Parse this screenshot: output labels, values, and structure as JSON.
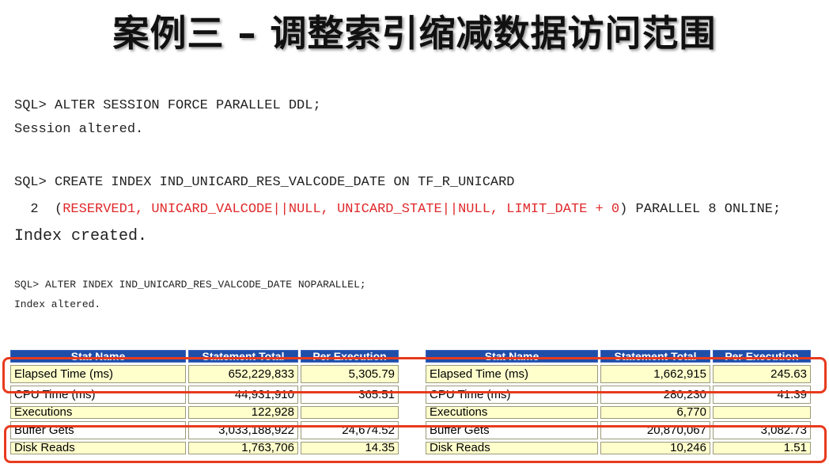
{
  "slide": {
    "title": "案例三 – 调整索引缩减数据访问范围"
  },
  "console": {
    "line1": "SQL> ALTER SESSION FORCE PARALLEL DDL;",
    "line2": "Session altered.",
    "line3": "SQL> CREATE INDEX IND_UNICARD_RES_VALCODE_DATE ON TF_R_UNICARD",
    "line4_prefix": "  2  (",
    "line4_red": "RESERVED1, UNICARD_VALCODE||NULL, UNICARD_STATE||NULL, LIMIT_DATE + 0",
    "line4_suffix": ") PARALLEL 8 ONLINE;",
    "line5": "Index created.",
    "line6": "SQL> ALTER INDEX IND_UNICARD_RES_VALCODE_DATE NOPARALLEL;",
    "line7": "Index altered."
  },
  "stats_before": {
    "headers": [
      "Stat Name",
      "Statement Total",
      "Per Execution"
    ],
    "rows": [
      {
        "name": "Elapsed Time (ms)",
        "total": "652,229,833",
        "per": "5,305.79"
      },
      {
        "name": "CPU Time (ms)",
        "total": "44,931,910",
        "per": "365.51"
      },
      {
        "name": "Executions",
        "total": "122,928",
        "per": ""
      },
      {
        "name": "Buffer Gets",
        "total": "3,033,188,922",
        "per": "24,674.52"
      },
      {
        "name": "Disk Reads",
        "total": "1,763,706",
        "per": "14.35"
      }
    ]
  },
  "stats_after": {
    "headers": [
      "Stat Name",
      "Statement Total",
      "Per Execution"
    ],
    "rows": [
      {
        "name": "Elapsed Time (ms)",
        "total": "1,662,915",
        "per": "245.63"
      },
      {
        "name": "CPU Time (ms)",
        "total": "280,230",
        "per": "41.39"
      },
      {
        "name": "Executions",
        "total": "6,770",
        "per": ""
      },
      {
        "name": "Buffer Gets",
        "total": "20,870,067",
        "per": "3,082.73"
      },
      {
        "name": "Disk Reads",
        "total": "10,246",
        "per": "1.51"
      }
    ]
  },
  "colors": {
    "header_bg": "#1f4ea8",
    "cell_bg": "#ffffcc",
    "highlight": "#e83a1e",
    "code_red": "#e0292b"
  }
}
